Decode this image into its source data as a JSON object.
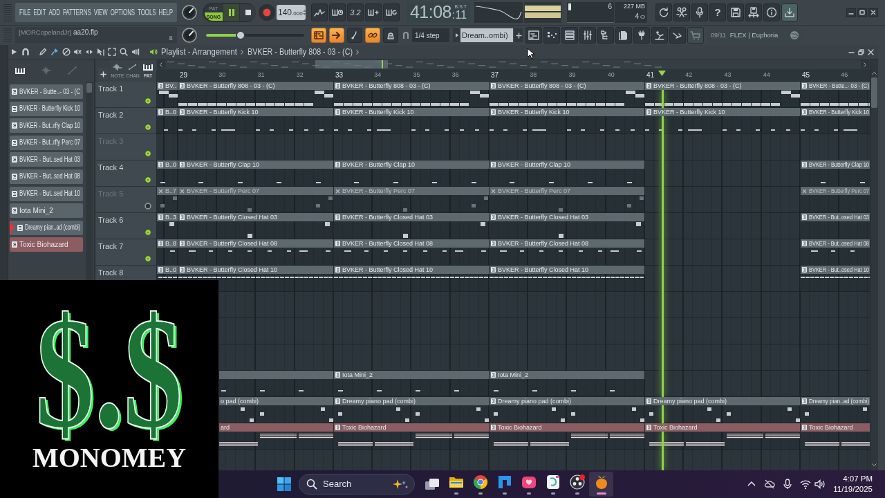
{
  "menu": [
    "FILE",
    "EDIT",
    "ADD",
    "PATTERNS",
    "VIEW",
    "OPTIONS",
    "TOOLS",
    "HELP"
  ],
  "hint": {
    "user": "[MORCopelandJr]",
    "file": "aa20.flp"
  },
  "transport": {
    "modes": [
      {
        "label": "PAT",
        "selected": false
      },
      {
        "label": "SONG",
        "selected": true
      }
    ],
    "playing": true
  },
  "tempo": {
    "whole": "140",
    "fraction": ".000"
  },
  "text_button": "3.2",
  "time": {
    "main": "41:08",
    "ticks": ":11",
    "format": "B:S:T"
  },
  "performance": {
    "cpu": "6",
    "memory": "227 MB",
    "polyphony": "4"
  },
  "help_button": "?",
  "master_volume": {
    "level": 0.35
  },
  "toggles": [
    {
      "on": true
    },
    {
      "on": true
    },
    {
      "on": false
    },
    {
      "on": true
    },
    {
      "on": false
    }
  ],
  "snap": "1/4 step",
  "pattern_selector": "Dream..ombi)",
  "news": {
    "date": "09/11",
    "title": "FLEX | Euphoria"
  },
  "playlist": {
    "title": "Playlist - Arrangement",
    "pattern": "BVKER - Butterfly 808 - 03 - (C)",
    "picker_tabs": [
      {
        "selected": true
      },
      {
        "selected": false
      },
      {
        "selected": false
      }
    ],
    "sources": [
      {
        "label": "NOTE",
        "selected": false
      },
      {
        "label": "CHAN",
        "selected": false
      },
      {
        "label": "PAT",
        "selected": true
      }
    ],
    "patterns": [
      {
        "label": "BVKER - Butte..- 03 - (C",
        "color": "#5a646b",
        "selected": false
      },
      {
        "label": "BVKER - Butterfly Kick 10",
        "color": "#5a646b",
        "selected": false
      },
      {
        "label": "BVKER - But..rfly Clap 10",
        "color": "#5a646b",
        "selected": false
      },
      {
        "label": "BVKER - But..rfly Perc 07",
        "color": "#5a646b",
        "selected": false
      },
      {
        "label": "BVKER - But..sed Hat 03",
        "color": "#5a646b",
        "selected": false
      },
      {
        "label": "BVKER - But..sed Hat 08",
        "color": "#5a646b",
        "selected": false
      },
      {
        "label": "BVKER - But..sed Hat 10",
        "color": "#5a646b",
        "selected": false
      },
      {
        "label": "Iota Mini_2",
        "color": "#5a646b",
        "selected": false
      },
      {
        "label": "Dreamy pian..ad (combi)",
        "color": "#5a646b",
        "selected": true
      },
      {
        "label": "Toxic Biohazard",
        "color": "#8d5c61",
        "selected": false
      }
    ],
    "ruler": [
      "29",
      "30",
      "31",
      "32",
      "33",
      "34",
      "35",
      "36",
      "37",
      "38",
      "39",
      "40",
      "41",
      "42",
      "43",
      "44",
      "45",
      "46"
    ],
    "tracks": [
      {
        "name": "Track 1",
        "muted": false,
        "color": "#5e686f",
        "clips": [
          {
            "label": "BV.."
          },
          {
            "label": "BVKER - Butterfly 808 - 03 - (C)"
          },
          {
            "label": "BVKER - Butterfly 808 - 03 - (C)"
          },
          {
            "label": "BVKER - Butterfly 808 - 03 - (C)"
          },
          {
            "label": "BVKER - Butterfly 808 - 03 - (C)"
          },
          {
            "label": "BVKER - Butte..- 03 - (C)"
          }
        ]
      },
      {
        "name": "Track 2",
        "muted": false,
        "color": "#5e686f",
        "clips": [
          {
            "label": "B..0"
          },
          {
            "label": "BVKER - Butterfly Kick 10"
          },
          {
            "label": "BVKER - Butterfly Kick 10"
          },
          {
            "label": "BVKER - Butterfly Kick 10"
          },
          {
            "label": "BVKER - Butterfly Kick 10"
          },
          {
            "label": "BVKER - Butterfly Kick 10"
          }
        ]
      },
      {
        "name": "Track 3",
        "muted": false
      },
      {
        "name": "Track 4",
        "muted": false,
        "color": "#5e686f",
        "clips": [
          {
            "label": "B..0"
          },
          {
            "label": "BVKER - Butterfly Clap 10"
          },
          {
            "label": "BVKER - Butterfly Clap 10"
          },
          {
            "label": "BVKER - Butterfly Clap 10"
          },
          {
            "label": "BVKER - Butterfly Clap 10",
            "gap_before": true
          }
        ]
      },
      {
        "name": "Track 5",
        "muted": true,
        "color": "#5e686f",
        "clips": [
          {
            "label": "B..7"
          },
          {
            "label": "BVKER - Butterfly Perc 07"
          },
          {
            "label": "BVKER - Butterfly Perc 07"
          },
          {
            "label": "BVKER - Butterfly Perc 07"
          },
          {
            "label": "BVKER - Butterfly Perc 07",
            "gap_before": true
          }
        ]
      },
      {
        "name": "Track 6",
        "muted": false,
        "color": "#5e686f",
        "clips": [
          {
            "label": "B..3"
          },
          {
            "label": "BVKER - Butterfly Closed Hat 03"
          },
          {
            "label": "BVKER - Butterfly Closed Hat 03"
          },
          {
            "label": "BVKER - Butterfly Closed Hat 03"
          },
          {
            "label": "BVKER - But..osed Hat 03",
            "gap_before": true
          }
        ]
      },
      {
        "name": "Track 7",
        "muted": false,
        "color": "#5e686f",
        "clips": [
          {
            "label": "B..8"
          },
          {
            "label": "BVKER - Butterfly Closed Hat 08"
          },
          {
            "label": "BVKER - Butterfly Closed Hat 08"
          },
          {
            "label": "BVKER - Butterfly Closed Hat 08"
          },
          {
            "label": "BVKER - But..osed Hat 08",
            "gap_before": true
          }
        ]
      },
      {
        "name": "Track 8",
        "color": "#5e686f",
        "clips": [
          {
            "label": "B..0"
          },
          {
            "label": "BVKER - Butterfly Closed Hat 10"
          },
          {
            "label": "BVKER - Butterfly Closed Hat 10"
          },
          {
            "label": "BVKER - Butterfly Closed Hat 10"
          },
          {
            "label": "BVKER - But..osed Hat 10",
            "gap_before": true
          }
        ]
      }
    ],
    "lower_tracks": [
      {
        "color": "#5e686f",
        "clips": [
          {
            "gap_before": false
          },
          {
            "label": "Iota Mini_2"
          },
          {
            "label": "Iota Mini_2"
          }
        ]
      },
      {
        "color": "#5e686f",
        "clips": [
          {
            "label": "o pad (combi)"
          },
          {
            "label": "Dreamy piano pad (combi)"
          },
          {
            "label": "Dreamy piano pad (combi)"
          },
          {
            "label": "Dreamy piano pad (combi)"
          },
          {
            "label": "Dreamy pian..ad (combi)"
          }
        ]
      },
      {
        "color": "#8b5d62",
        "clips": [
          {
            "label": "ard"
          },
          {
            "label": "Toxic Biohazard"
          },
          {
            "label": "Toxic Biohazard"
          },
          {
            "label": "Toxic Biohazard"
          },
          {
            "label": "Toxic Biohazard"
          }
        ]
      }
    ]
  },
  "overlay_logo": {
    "symbol": "$.$",
    "name": "MONOMEY"
  },
  "taskbar": {
    "search": {
      "placeholder": "Search"
    },
    "apps": [
      {
        "running": true,
        "selected": false
      },
      {
        "running": true,
        "selected": false
      },
      {
        "running": true,
        "selected": false
      },
      {
        "running": true,
        "selected": false
      },
      {
        "running": true,
        "selected": false
      },
      {
        "running": true,
        "selected": false
      },
      {
        "running": true,
        "selected": true
      }
    ],
    "time": "4:07 PM",
    "date": "11/19/2025"
  }
}
